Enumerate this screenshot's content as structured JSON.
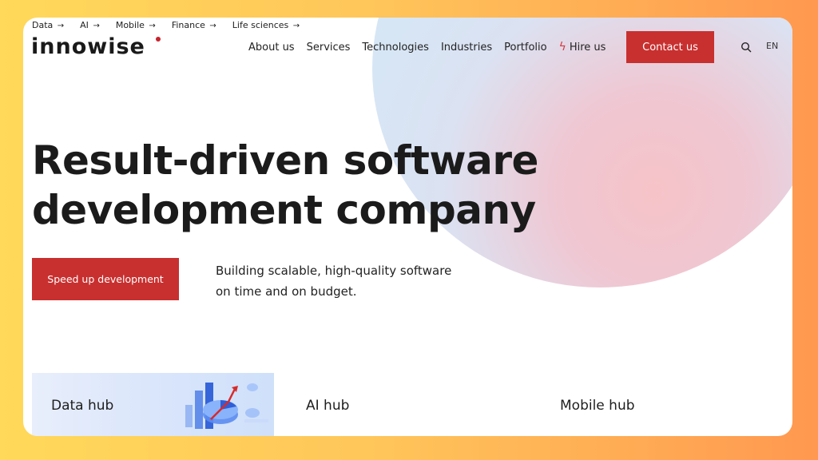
{
  "topnav": [
    {
      "label": "Data",
      "arrow": "→"
    },
    {
      "label": "AI",
      "arrow": "→"
    },
    {
      "label": "Mobile",
      "arrow": "→"
    },
    {
      "label": "Finance",
      "arrow": "→"
    },
    {
      "label": "Life sciences",
      "arrow": "→"
    }
  ],
  "logo": {
    "text": "innowise"
  },
  "mainnav": {
    "items": [
      "About us",
      "Services",
      "Technologies",
      "Industries",
      "Portfolio"
    ],
    "hire": "Hire us"
  },
  "header": {
    "contact_label": "Contact us",
    "lang": "EN"
  },
  "hero": {
    "title_line1": "Result-driven software",
    "title_line2": "development company",
    "cta_label": "Speed up development",
    "sub_line1": "Building scalable, high-quality software",
    "sub_line2": "on time and on budget."
  },
  "hubs": [
    {
      "label": "Data hub"
    },
    {
      "label": "AI hub"
    },
    {
      "label": "Mobile hub"
    }
  ],
  "colors": {
    "accent": "#c8302f",
    "text": "#1b1b1b"
  }
}
